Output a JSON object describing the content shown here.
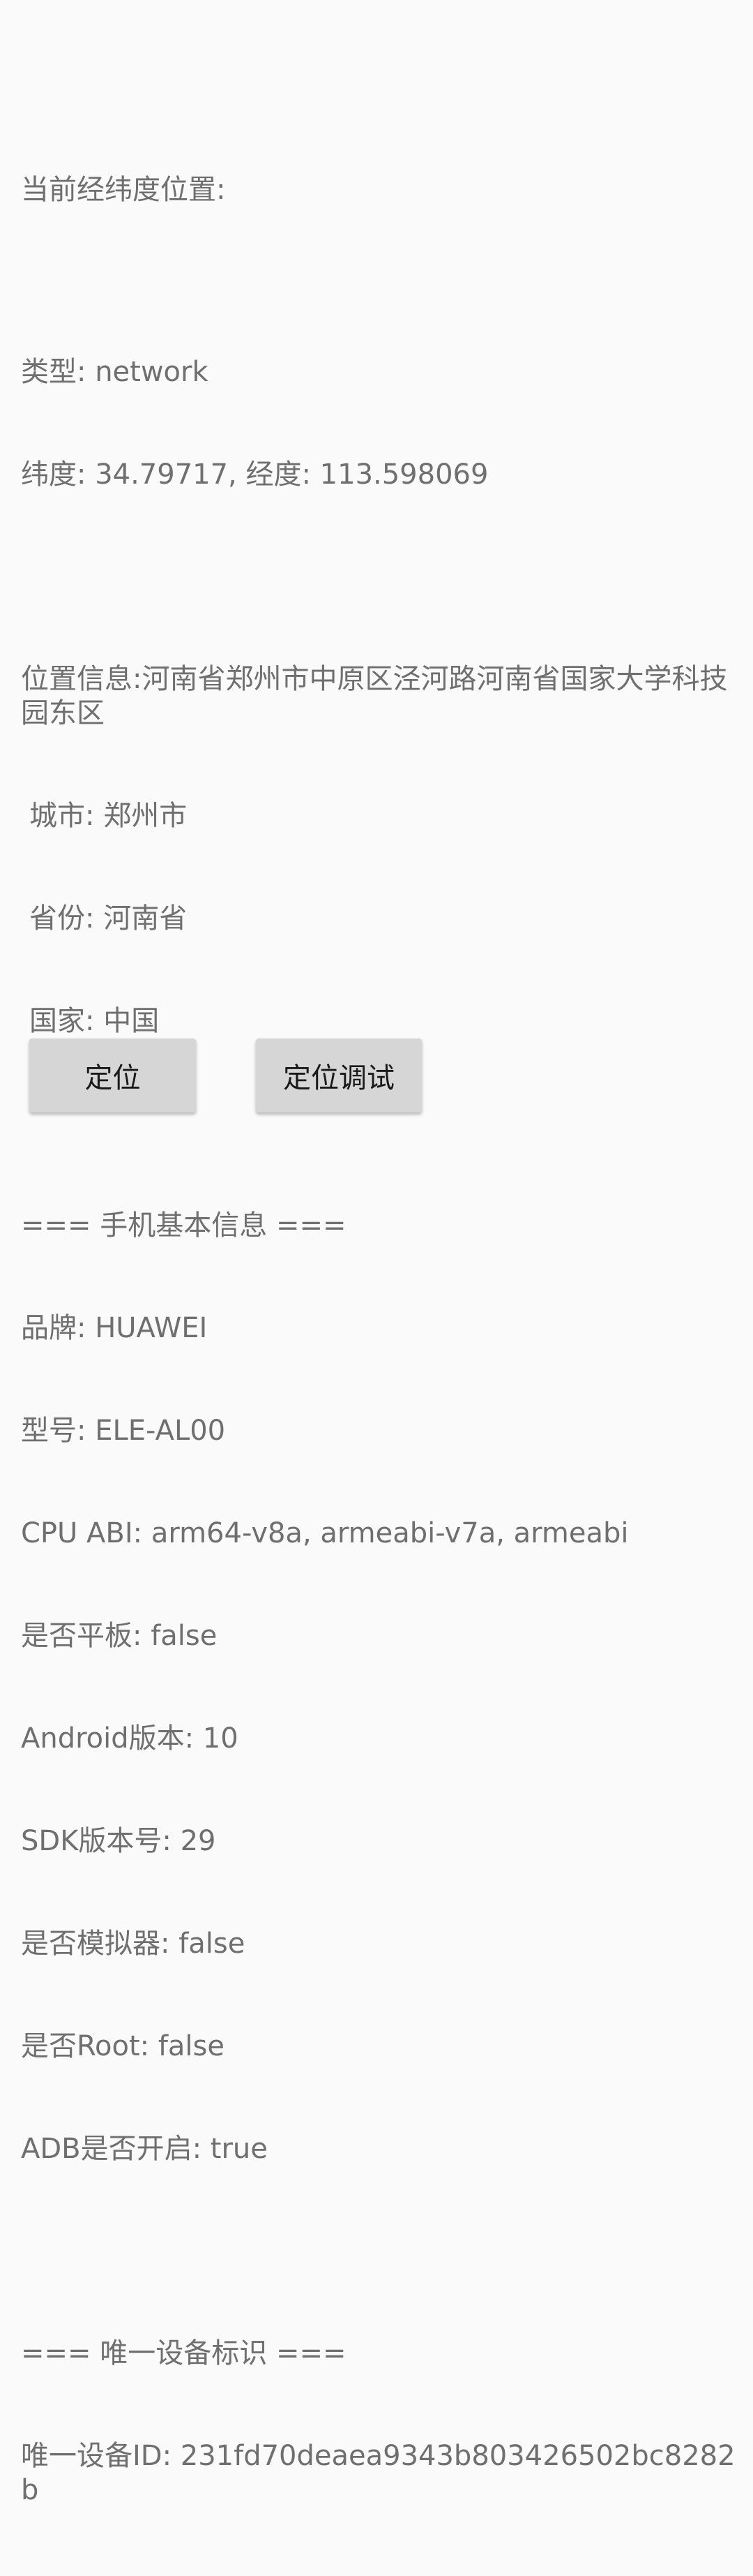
{
  "location": {
    "heading": "当前经纬度位置:",
    "type_line": "类型: network",
    "coords_line": "纬度: 34.79717, 经度: 113.598069",
    "address_line": "位置信息:河南省郑州市中原区泾河路河南省国家大学科技园东区",
    "city_line": "城市: 郑州市",
    "province_line": "省份: 河南省",
    "country_line": "国家: 中国"
  },
  "device": {
    "heading": "=== 手机基本信息 ===",
    "brand_line": "品牌: HUAWEI",
    "model_line": "型号: ELE-AL00",
    "cpu_line": "CPU ABI: arm64-v8a, armeabi-v7a, armeabi",
    "tablet_line": "是否平板: false",
    "android_line": "Android版本: 10",
    "sdk_line": "SDK版本号: 29",
    "emulator_line": "是否模拟器: false",
    "root_line": "是否Root: false",
    "adb_line": "ADB是否开启: true"
  },
  "identifier": {
    "heading": "=== 唯一设备标识 ===",
    "id_line": "唯一设备ID: 231fd70deaea9343b803426502bc8282b"
  },
  "buttons": {
    "locate_label": "定位",
    "debug_label": "定位调试"
  }
}
